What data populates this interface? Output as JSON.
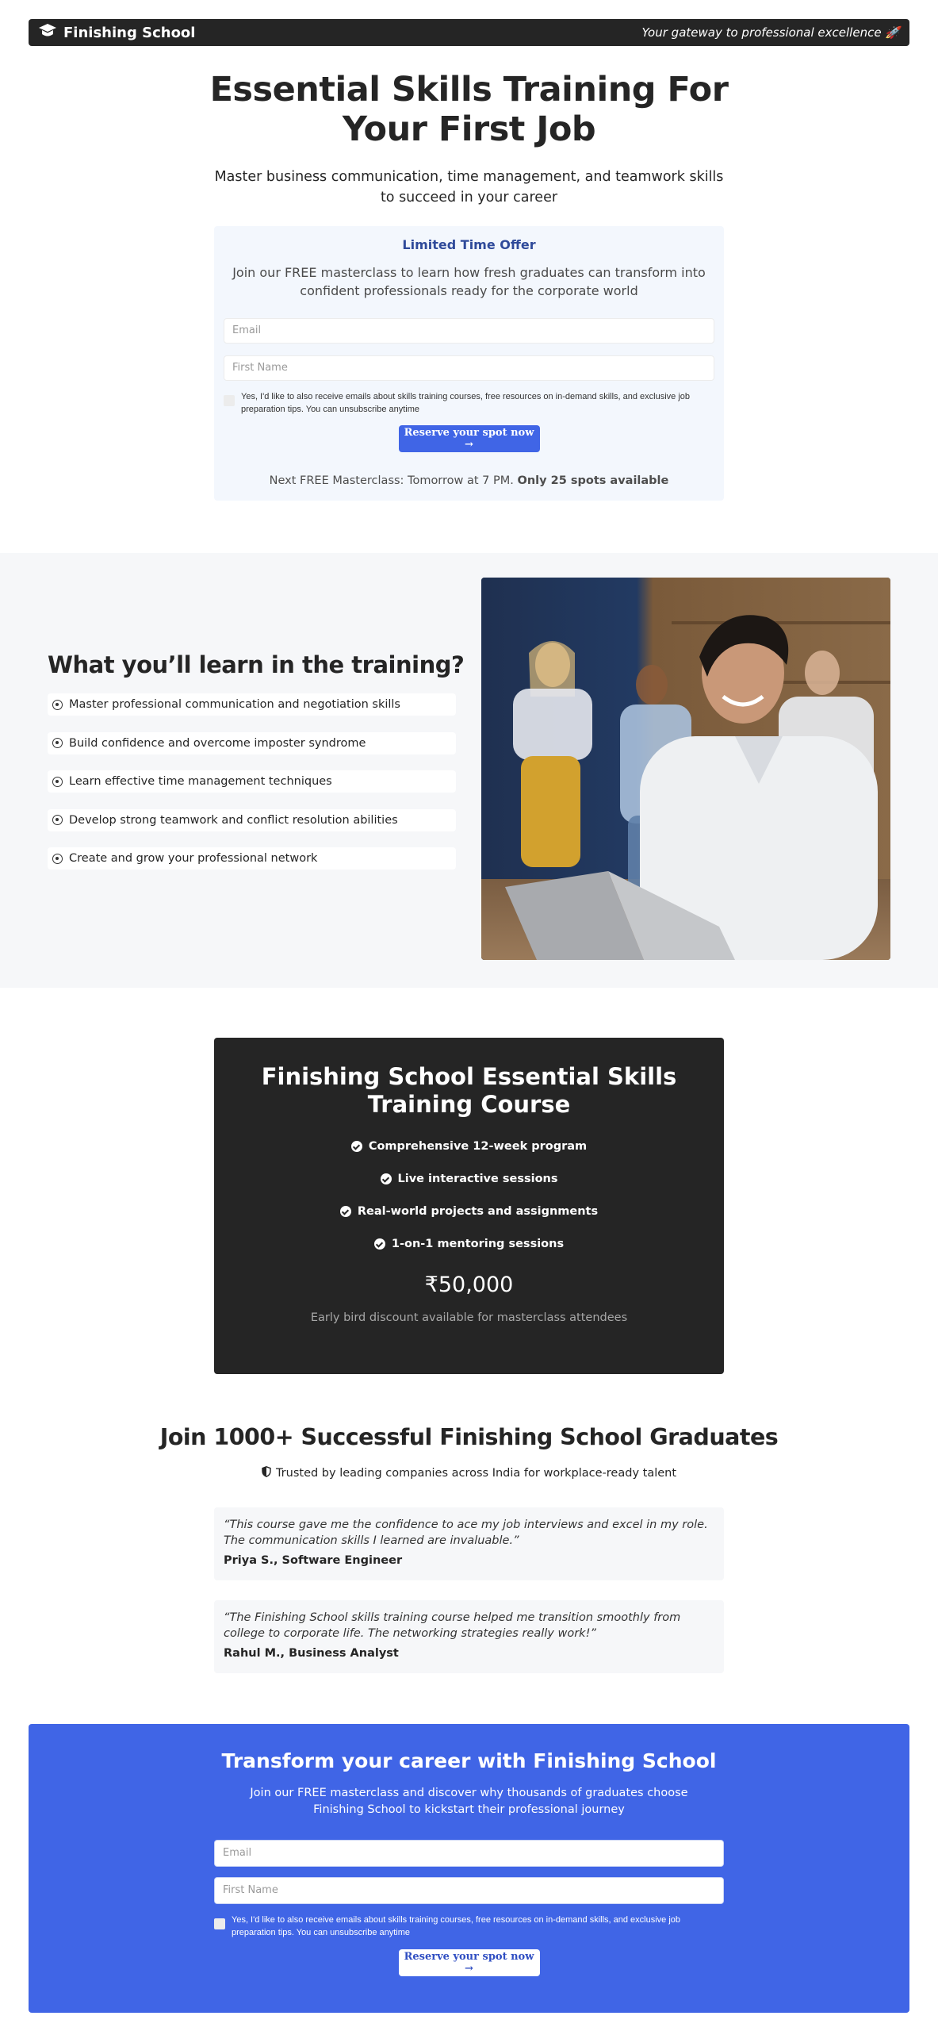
{
  "header": {
    "brand": "Finishing School",
    "tagline": "Your gateway to professional excellence 🚀"
  },
  "hero": {
    "title_line1": "Essential Skills Training For",
    "title_line2": "Your First Job",
    "subtitle": "Master business communication, time management, and teamwork skills to succeed in your career"
  },
  "offer": {
    "title": "Limited Time Offer",
    "description": "Join our FREE masterclass to learn how fresh graduates can transform into confident professionals ready for the corporate world",
    "email_placeholder": "Email",
    "first_name_placeholder": "First Name",
    "consent": "Yes, I'd like to also receive emails about skills training courses, free resources on in-demand skills, and exclusive job preparation tips. You can unsubscribe anytime",
    "consent_checked": false,
    "cta": "Reserve your spot now →",
    "next_prefix": "Next FREE Masterclass: Tomorrow at 7 PM. ",
    "next_bold": "Only 25 spots available"
  },
  "learn": {
    "title": "What you’ll learn in the training?",
    "items": [
      "Master professional communication and negotiation skills",
      "Build confidence and overcome imposter syndrome",
      "Learn effective time management techniques",
      "Develop strong teamwork and conflict resolution abilities",
      "Create and grow your professional network"
    ],
    "image_alt": "Smiling young professional with laptop in office with colleagues behind"
  },
  "course": {
    "title": "Finishing School Essential Skills Training Course",
    "features": [
      "Comprehensive 12-week program",
      "Live interactive sessions",
      "Real-world projects and assignments",
      "1-on-1 mentoring sessions"
    ],
    "price": "₹50,000",
    "price_note": "Early bird discount available for masterclass attendees"
  },
  "graduates": {
    "title": "Join 1000+ Successful Finishing School Graduates",
    "trusted": "Trusted by leading companies across India for workplace-ready talent",
    "testimonials": [
      {
        "quote": "“This course gave me the confidence to ace my job interviews and excel in my role. The communication skills I learned are invaluable.”",
        "author": "Priya S., Software Engineer"
      },
      {
        "quote": "“The Finishing School skills training course helped me transition smoothly from college to corporate life. The networking strategies really work!”",
        "author": "Rahul M., Business Analyst"
      }
    ]
  },
  "final_cta": {
    "title": "Transform your career with Finishing School",
    "description": "Join our FREE masterclass and discover why thousands of graduates choose Finishing School to kickstart their professional journey",
    "email_placeholder": "Email",
    "first_name_placeholder": "First Name",
    "consent": "Yes, I'd like to also receive emails about skills training courses, free resources on in-demand skills, and exclusive job preparation tips. You can unsubscribe anytime",
    "consent_checked": false,
    "cta": "Reserve your spot now →"
  },
  "colors": {
    "dark": "#252525",
    "accent_blue": "#4065e6",
    "offer_title_blue": "#2f4a9a",
    "offer_bg": "#f3f7fd",
    "section_bg": "#f6f7f9"
  }
}
